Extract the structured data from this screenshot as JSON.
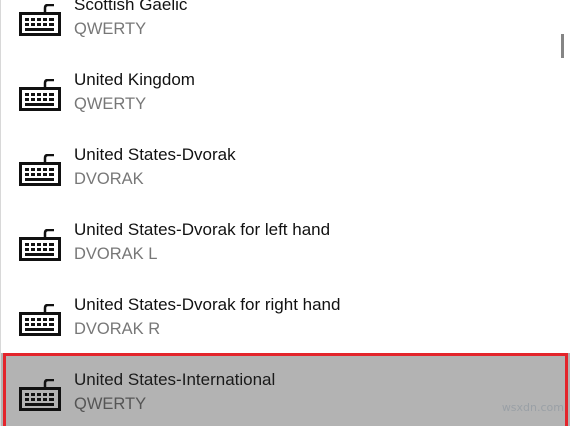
{
  "keyboard_list": {
    "items": [
      {
        "name": "Scottish Gaelic",
        "layout": "QWERTY",
        "icon": "keyboard-icon"
      },
      {
        "name": "United Kingdom",
        "layout": "QWERTY",
        "icon": "keyboard-icon"
      },
      {
        "name": "United States-Dvorak",
        "layout": "DVORAK",
        "icon": "keyboard-icon"
      },
      {
        "name": "United States-Dvorak for left hand",
        "layout": "DVORAK L",
        "icon": "keyboard-icon"
      },
      {
        "name": "United States-Dvorak for right hand",
        "layout": "DVORAK R",
        "icon": "keyboard-icon"
      },
      {
        "name": "United States-International",
        "layout": "QWERTY",
        "icon": "keyboard-icon",
        "selected": true
      }
    ]
  },
  "colors": {
    "selection_background": "#b3b3b3",
    "highlight_border": "#e3242b",
    "secondary_text": "#777777"
  },
  "watermark": "wsxdn.com"
}
